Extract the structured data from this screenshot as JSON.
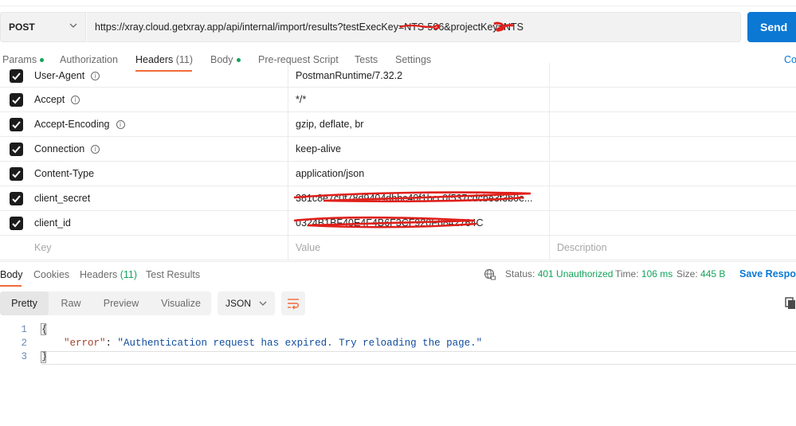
{
  "request": {
    "method": "POST",
    "url": "https://xray.cloud.getxray.app/api/internal/import/results?testExecKey=NTS-506&projectKey=NTS",
    "send_label": "Send"
  },
  "request_tabs": [
    {
      "label": "Params",
      "count": "",
      "dot": true
    },
    {
      "label": "Authorization",
      "count": "",
      "dot": false
    },
    {
      "label": "Headers",
      "count": "(11)",
      "dot": false
    },
    {
      "label": "Body",
      "count": "",
      "dot": true
    },
    {
      "label": "Pre-request Script",
      "count": "",
      "dot": false
    },
    {
      "label": "Tests",
      "count": "",
      "dot": false
    },
    {
      "label": "Settings",
      "count": "",
      "dot": false
    }
  ],
  "cookies_label": "Co",
  "headers": [
    {
      "key": "User-Agent",
      "value": "PostmanRuntime/7.32.2",
      "info": true
    },
    {
      "key": "Accept",
      "value": "*/*",
      "info": true
    },
    {
      "key": "Accept-Encoding",
      "value": "gzip, deflate, br",
      "info": true
    },
    {
      "key": "Connection",
      "value": "keep-alive",
      "info": true
    },
    {
      "key": "Content-Type",
      "value": "application/json",
      "info": false
    },
    {
      "key": "client_secret",
      "value": "381c8e7c0f78d9404dbbc40f1bcc0f537cdcbe3f3b0e...",
      "info": false
    },
    {
      "key": "client_id",
      "value": "0324B1BF40E4F4B6F3CF920F6842764C",
      "info": false
    }
  ],
  "new_row": {
    "key_placeholder": "Key",
    "value_placeholder": "Value",
    "description_placeholder": "Description"
  },
  "response_tabs": [
    {
      "label": "Body",
      "count": ""
    },
    {
      "label": "Cookies",
      "count": ""
    },
    {
      "label": "Headers",
      "count": "(11)"
    },
    {
      "label": "Test Results",
      "count": ""
    }
  ],
  "response_status": {
    "status_label": "Status:",
    "status_value": "401 Unauthorized",
    "time_label": "Time:",
    "time_value": "106 ms",
    "size_label": "Size:",
    "size_value": "445 B",
    "save_label": "Save Respon"
  },
  "view_modes": [
    "Pretty",
    "Raw",
    "Preview",
    "Visualize"
  ],
  "format": "JSON",
  "code": {
    "line_numbers": [
      "1",
      "2",
      "3"
    ],
    "open_brace": "{",
    "key": "\"error\"",
    "colon": ": ",
    "value": "\"Authentication request has expired. Try reloading the page.\"",
    "close_brace": "}"
  },
  "colors": {
    "send": "#0b78d4",
    "active_tab": "#f26b3a",
    "status_ok": "#14a35b",
    "redaction": "#e0201b"
  }
}
